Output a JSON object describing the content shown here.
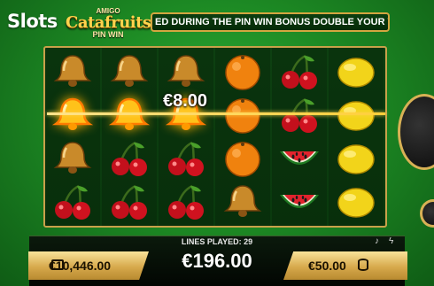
{
  "header": {
    "site_logo": "Slots",
    "game_logo_top": "AMIGO",
    "game_logo_main": "Catafruits",
    "game_logo_bottom": "PIN WIN",
    "ticker_text": "ED DURING THE PIN WIN BONUS DOUBLE YOUR WIN"
  },
  "reels": [
    [
      "bell",
      "bell-gold",
      "bell",
      "cherry"
    ],
    [
      "bell",
      "bell-gold",
      "cherry",
      "cherry"
    ],
    [
      "bell",
      "bell-gold",
      "cherry",
      "cherry"
    ],
    [
      "orange",
      "orange",
      "orange",
      "bell"
    ],
    [
      "cherry",
      "cherry",
      "watermelon",
      "watermelon"
    ],
    [
      "lemon",
      "lemon",
      "lemon",
      "lemon"
    ]
  ],
  "win_line_amount": "€8.00",
  "footer": {
    "lines_played": "LINES PLAYED: 29",
    "balance": "€10,446.00",
    "win": "€196.00",
    "bet": "€50.00"
  },
  "colors": {
    "gold": "#d8b155",
    "bg_green": "#1d8a24",
    "reel_bg": "#0d4011"
  }
}
